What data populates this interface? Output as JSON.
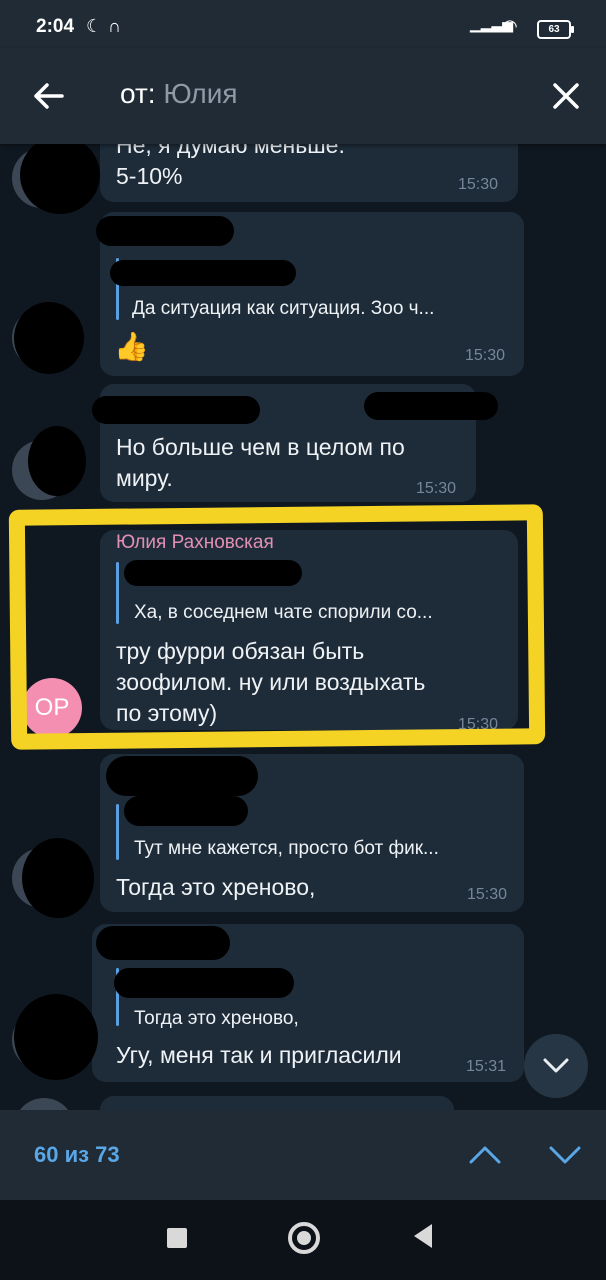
{
  "status_bar": {
    "time": "2:04",
    "battery": "63"
  },
  "header": {
    "prefix": "от:",
    "query": "Юлия"
  },
  "messages": [
    {
      "text": "Не, я думаю меньше.\n5-10%",
      "time": "15:30"
    },
    {
      "reply_text": "Да ситуация как ситуация. Зоо ч...",
      "emoji": "👍",
      "time": "15:30"
    },
    {
      "text": "Но больше чем в целом по\nмиру.",
      "time": "15:30"
    },
    {
      "author": "Юлия Рахновская",
      "avatar_initials": "OP",
      "reply_text": "Ха, в соседнем чате спорили со...",
      "text": "тру фурри обязан быть\nзоофилом. ну или воздыхать\nпо этому)",
      "time": "15:30"
    },
    {
      "reply_text": "Тут мне кажется, просто бот фик...",
      "text": "Тогда это хреново,",
      "time": "15:30"
    },
    {
      "reply_text": "Тогда это хреново,",
      "text": "Угу, меня так и пригласили",
      "time": "15:31"
    }
  ],
  "bottom_bar": {
    "counter": "60 из 73"
  },
  "colors": {
    "highlight": "#f4d324",
    "accent": "#5aa7e8",
    "author": "#e38fb3"
  }
}
